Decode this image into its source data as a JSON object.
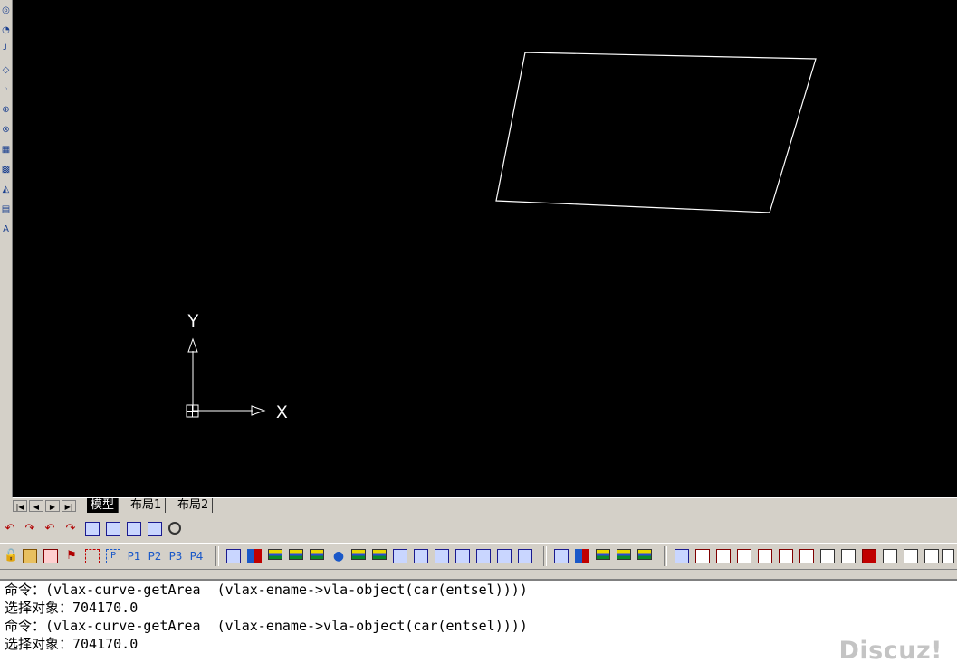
{
  "drawing": {
    "axis_x_label": "X",
    "axis_y_label": "Y"
  },
  "layout_tabs": {
    "model": "模型",
    "layout1": "布局1",
    "layout2": "布局2"
  },
  "toolbar2": {
    "p_labels": [
      "P1",
      "P2",
      "P3",
      "P4"
    ]
  },
  "command_history": [
    "命令：(vlax-curve-getArea  (vlax-ename->vla-object(car(entsel))))",
    "选择对象：704170.0",
    "命令：(vlax-curve-getArea  (vlax-ename->vla-object(car(entsel))))",
    "选择对象：704170.0"
  ],
  "watermark": "Discuz!",
  "colors": {
    "canvas_bg": "#000000",
    "drawing_stroke": "#ffffff",
    "chrome": "#d4d0c8"
  }
}
